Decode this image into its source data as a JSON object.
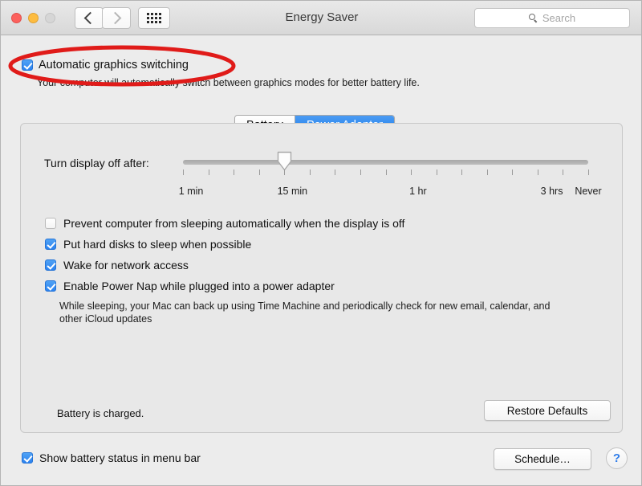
{
  "window": {
    "title": "Energy Saver",
    "traffic_lights": [
      "close",
      "minimize",
      "zoom-disabled"
    ]
  },
  "toolbar": {
    "back_label": "‹",
    "forward_label": "›",
    "grid_label": "show-all-grid",
    "search_placeholder": "Search"
  },
  "graphics": {
    "checkbox_label": "Automatic graphics switching",
    "checked": true,
    "description": "Your computer will automatically switch between graphics modes for better battery life."
  },
  "annotation": {
    "shape": "ellipse",
    "color": "#e01b19"
  },
  "tabs": [
    {
      "label": "Battery",
      "active": false
    },
    {
      "label": "Power Adapter",
      "active": true
    }
  ],
  "slider": {
    "label": "Turn display off after:",
    "value_index": 4,
    "tick_count": 17,
    "tick_labels": [
      {
        "text": "1 min",
        "position_pct": 2
      },
      {
        "text": "15 min",
        "position_pct": 27
      },
      {
        "text": "1 hr",
        "position_pct": 58
      },
      {
        "text": "3 hrs",
        "position_pct": 91
      },
      {
        "text": "Never",
        "position_pct": 100
      }
    ]
  },
  "options": [
    {
      "label": "Prevent computer from sleeping automatically when the display is off",
      "checked": false
    },
    {
      "label": "Put hard disks to sleep when possible",
      "checked": true
    },
    {
      "label": "Wake for network access",
      "checked": true
    },
    {
      "label": "Enable Power Nap while plugged into a power adapter",
      "checked": true
    }
  ],
  "power_nap_description": "While sleeping, your Mac can back up using Time Machine and periodically check for new email, calendar, and other iCloud updates",
  "footer": {
    "battery_status": "Battery is charged.",
    "restore_defaults_label": "Restore Defaults",
    "show_battery_label": "Show battery status in menu bar",
    "show_battery_checked": true,
    "schedule_label": "Schedule…",
    "help_label": "?"
  },
  "colors": {
    "accent_blue": "#2b82ef",
    "annotation_red": "#e01b19",
    "window_bg": "#ececec",
    "panel_bg": "#e8e8e8"
  }
}
